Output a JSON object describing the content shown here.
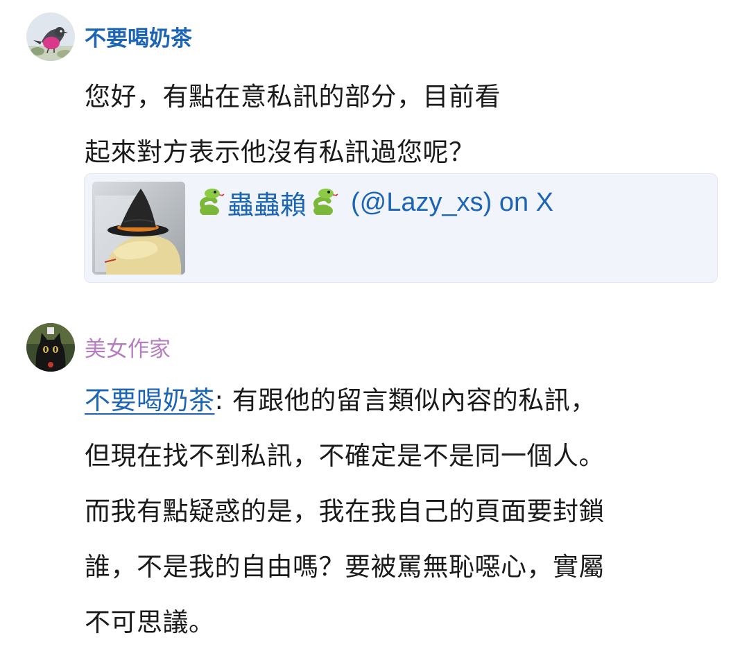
{
  "comments": [
    {
      "username": "不要喝奶茶",
      "username_color": "#1c64b4",
      "body_lines": [
        "您好，有點在意私訊的部分，目前看",
        "起來對方表示他沒有私訊過您呢？"
      ],
      "embed": {
        "title_before_handle": "蟲蟲賴",
        "title_handle": "(@Lazy_xs) on X",
        "title_icon": "snake-emoji"
      }
    },
    {
      "username": "美女作家",
      "username_color": "#b67ec0",
      "mention": "不要喝奶茶",
      "mention_suffix": ": 有跟他的留言類似內容的私訊，",
      "body_lines": [
        "但現在找不到私訊，不確定是不是同一個人。",
        "而我有點疑惑的是，我在我自己的頁面要封鎖",
        "誰，不是我的自由嗎？要被罵無恥噁心，實屬",
        "不可思議。"
      ]
    }
  ],
  "colors": {
    "link": "#1c64b4",
    "embed_bg": "#f1f4fb",
    "text": "#1a1a1a"
  }
}
